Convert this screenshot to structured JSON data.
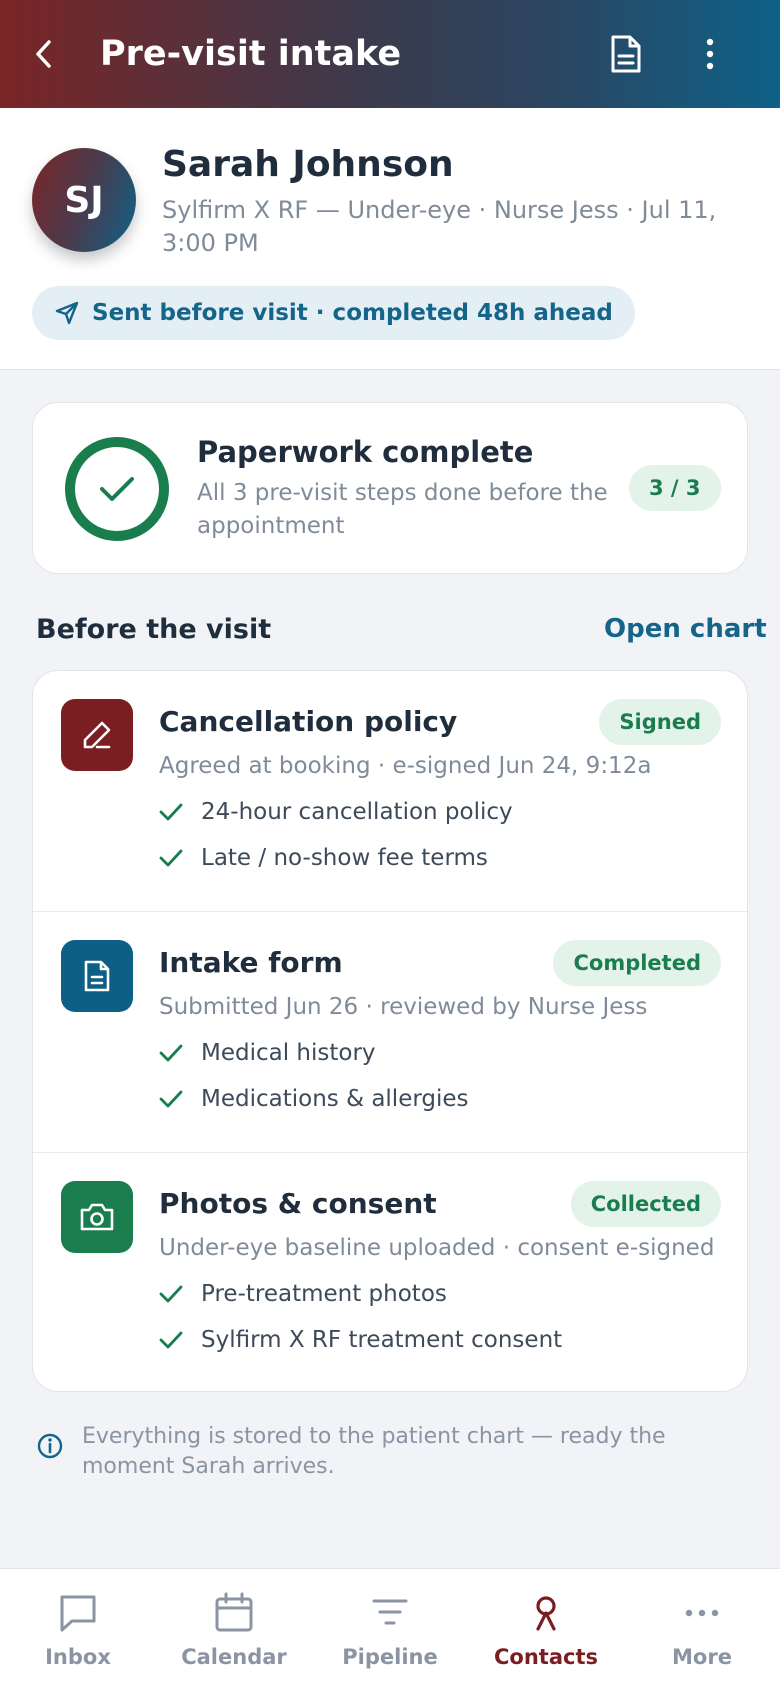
{
  "header": {
    "title": "Pre-visit intake",
    "back_icon": "chevron-left-icon",
    "document_icon": "document-icon",
    "more_icon": "more-vertical-icon"
  },
  "patient": {
    "initials": "SJ",
    "name": "Sarah Johnson",
    "appointment": "Sylfirm X RF — Under-eye · Nurse Jess · Jul 11, 3:00 PM",
    "sent_status": "Sent before visit · completed 48h ahead"
  },
  "summary": {
    "title": "Paperwork complete",
    "subtitle": "All 3 pre-visit steps done before the appointment",
    "count": "3 / 3"
  },
  "section": {
    "title": "Before the visit",
    "link": "Open chart"
  },
  "steps": [
    {
      "title": "Cancellation policy",
      "status": "Signed",
      "detail": "Agreed at booking · e-signed Jun 24, 9:12a",
      "checks": [
        "24-hour cancellation policy",
        "Late / no-show fee terms"
      ],
      "icon": "pen-icon",
      "color": "#7a1e22"
    },
    {
      "title": "Intake form",
      "status": "Completed",
      "detail": "Submitted Jun 26 · reviewed by Nurse Jess",
      "checks": [
        "Medical history",
        "Medications & allergies"
      ],
      "icon": "form-icon",
      "color": "#0e5f88"
    },
    {
      "title": "Photos & consent",
      "status": "Collected",
      "detail": "Under-eye baseline uploaded · consent e-signed",
      "checks": [
        "Pre-treatment photos",
        "Sylfirm X RF treatment consent"
      ],
      "icon": "camera-icon",
      "color": "#1a7d4e"
    }
  ],
  "info_note": "Everything is stored to the patient chart — ready the moment Sarah arrives.",
  "nav": [
    {
      "label": "Inbox",
      "icon": "chat-icon"
    },
    {
      "label": "Calendar",
      "icon": "calendar-icon"
    },
    {
      "label": "Pipeline",
      "icon": "filter-icon"
    },
    {
      "label": "Contacts",
      "icon": "contact-icon",
      "active": true
    },
    {
      "label": "More",
      "icon": "more-horizontal-icon"
    }
  ],
  "colors": {
    "accent_blue": "#15648a",
    "accent_green": "#1a7d4e",
    "accent_maroon": "#7a1e22"
  }
}
